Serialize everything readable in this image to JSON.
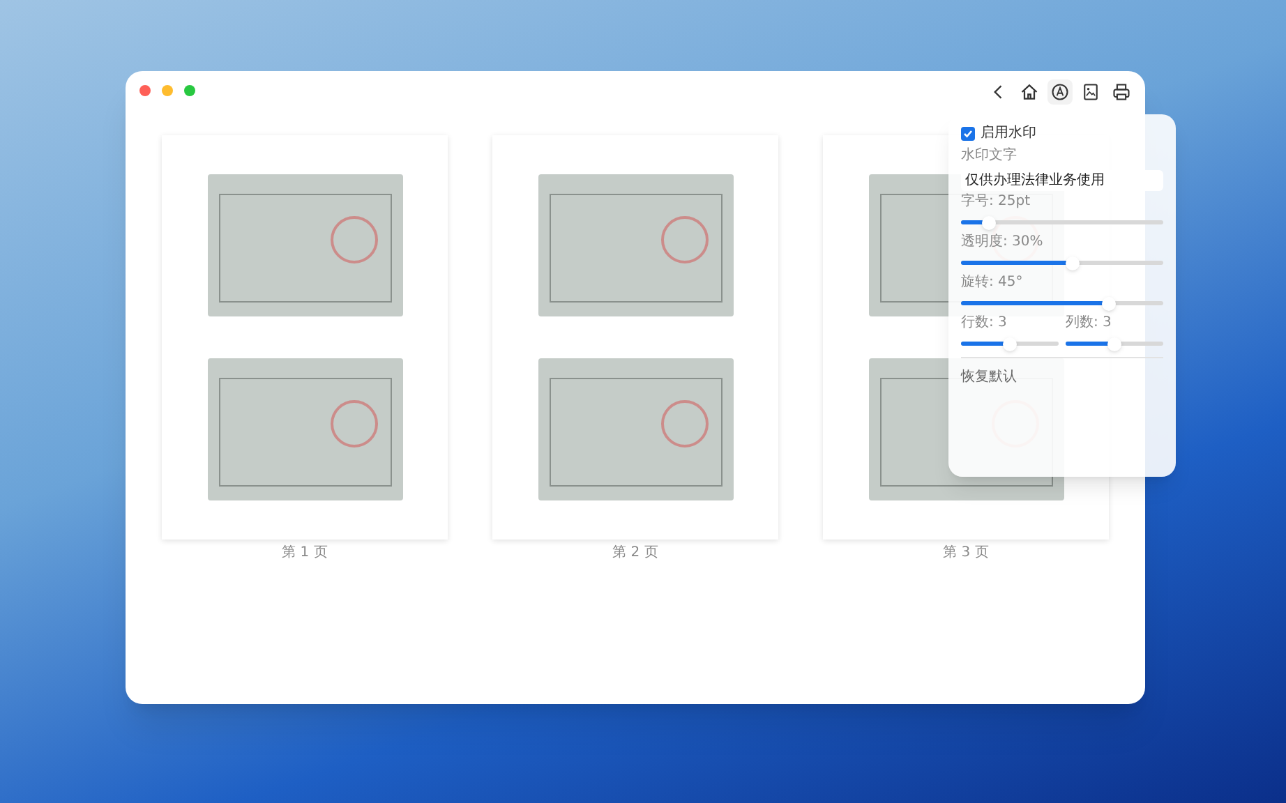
{
  "toolbar": {
    "buttons": [
      {
        "kind": "back"
      },
      {
        "kind": "home"
      },
      {
        "kind": "watermark",
        "selected": true
      },
      {
        "kind": "image"
      },
      {
        "kind": "print"
      }
    ]
  },
  "pages": [
    {
      "label": "第 1 页"
    },
    {
      "label": "第 2 页"
    },
    {
      "label": "第 3 页"
    }
  ],
  "watermark_panel": {
    "enable": {
      "label": "启用水印",
      "checked": true
    },
    "text_field": {
      "label": "水印文字",
      "value": "仅供办理法律业务使用"
    },
    "sliders": [
      {
        "label": "字号: 25pt",
        "level": 0.14
      },
      {
        "label": "透明度: 30%",
        "level": 0.55
      },
      {
        "label": "旋转: 45°",
        "level": 0.73
      }
    ],
    "half_sliders": [
      {
        "label": "行数: 3",
        "level": 0.5
      },
      {
        "label": "列数: 3",
        "level": 0.5
      }
    ],
    "reset_button": "恢复默认"
  }
}
